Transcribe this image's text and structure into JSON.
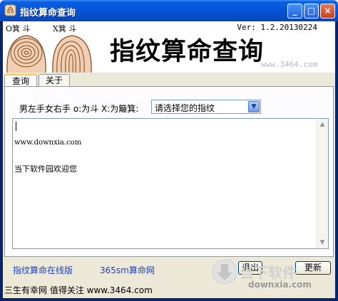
{
  "window": {
    "title": "指纹算命查询",
    "minimize": "_",
    "maximize": "□",
    "close": "×"
  },
  "header": {
    "left_label": "O箕 斗",
    "right_label": "X箕 斗",
    "version": "Ver: 1.2.20130224",
    "title": "指纹算命查询",
    "watermark": "www.3464.com"
  },
  "tabs": [
    {
      "label": "查询",
      "active": true
    },
    {
      "label": "关于",
      "active": false
    }
  ],
  "query": {
    "hint": "男左手女右手 o:为斗 X:为簸箕:",
    "select_value": "请选择您的指纹",
    "output_lines": [
      "www.downxia.com",
      "当下软件园欢迎您"
    ]
  },
  "bottom": {
    "link1": "指纹算命在线版",
    "link2": "365sm算命网",
    "exit_button": "退出",
    "refresh_button": "更新",
    "footer": "三生有幸网 值得关注 www.3464.com",
    "logo_text": "当下软件",
    "logo_url": "downxia.com"
  },
  "colors": {
    "title_bar": "#0654d8",
    "link": "#1c3fbf",
    "tab_highlight": "#ffc83c"
  }
}
